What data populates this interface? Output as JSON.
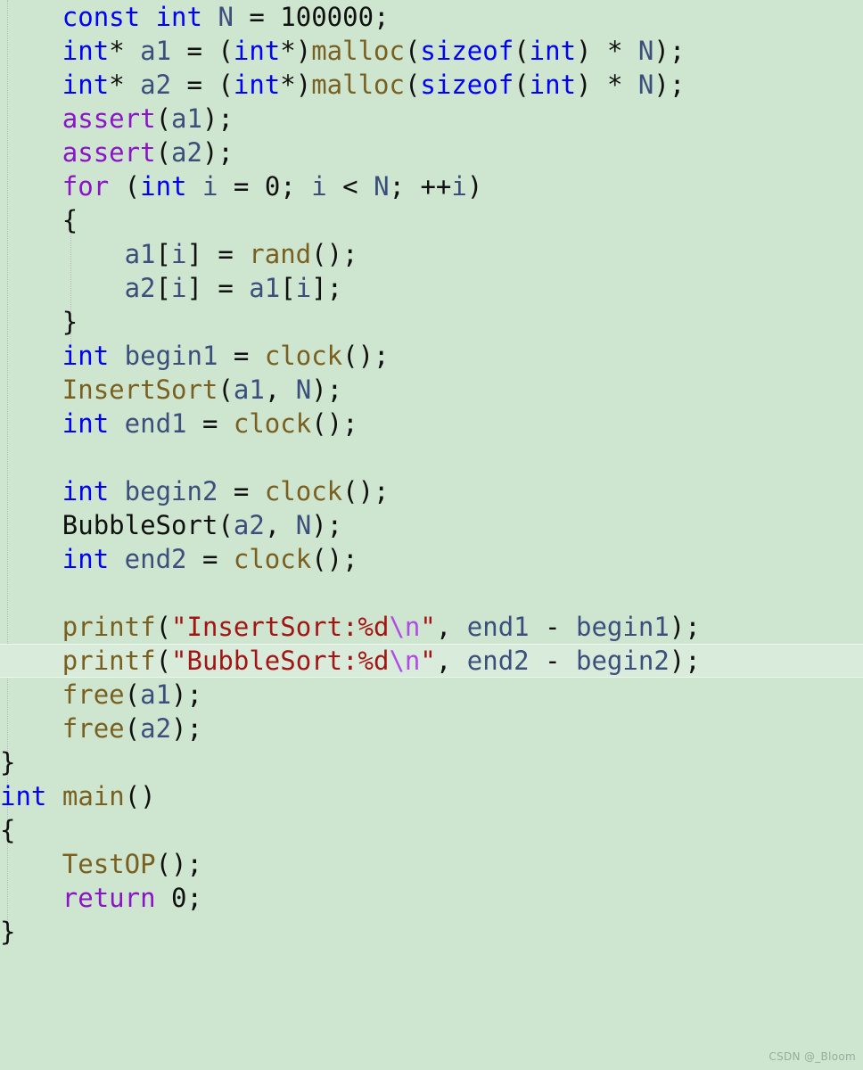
{
  "editor": {
    "background_color": "#cee6d0",
    "current_line_background": "#d9ecdb",
    "language": "C",
    "font_size_px": 29,
    "line_height_px": 38,
    "indent_guide_color": "#b9b2bd",
    "current_line_number_in_view": 18
  },
  "palette": {
    "keyword": "#0000ff",
    "control": "#8b13c9",
    "macro": "#8b13c9",
    "function": "#7a6020",
    "variable": "#3c4f7c",
    "string": "#a31515",
    "escape": "#b14ae8",
    "number": "#101010",
    "punctuation": "#101010",
    "plain": "#101010"
  },
  "watermark": {
    "text": "CSDN @_Bloom"
  },
  "code": {
    "lines": [
      {
        "indent": 4,
        "current": false,
        "tokens": [
          {
            "t": "const",
            "c": "kw"
          },
          {
            "t": " ",
            "c": "pun"
          },
          {
            "t": "int",
            "c": "kw"
          },
          {
            "t": " ",
            "c": "pun"
          },
          {
            "t": "N",
            "c": "var"
          },
          {
            "t": " = ",
            "c": "pun"
          },
          {
            "t": "100000",
            "c": "num"
          },
          {
            "t": ";",
            "c": "pun"
          }
        ]
      },
      {
        "indent": 4,
        "current": false,
        "tokens": [
          {
            "t": "int",
            "c": "kw"
          },
          {
            "t": "* ",
            "c": "pun"
          },
          {
            "t": "a1",
            "c": "var"
          },
          {
            "t": " = (",
            "c": "pun"
          },
          {
            "t": "int",
            "c": "kw"
          },
          {
            "t": "*)",
            "c": "pun"
          },
          {
            "t": "malloc",
            "c": "fn"
          },
          {
            "t": "(",
            "c": "pun"
          },
          {
            "t": "sizeof",
            "c": "kw"
          },
          {
            "t": "(",
            "c": "pun"
          },
          {
            "t": "int",
            "c": "kw"
          },
          {
            "t": ") * ",
            "c": "pun"
          },
          {
            "t": "N",
            "c": "var"
          },
          {
            "t": ");",
            "c": "pun"
          }
        ]
      },
      {
        "indent": 4,
        "current": false,
        "tokens": [
          {
            "t": "int",
            "c": "kw"
          },
          {
            "t": "* ",
            "c": "pun"
          },
          {
            "t": "a2",
            "c": "var"
          },
          {
            "t": " = (",
            "c": "pun"
          },
          {
            "t": "int",
            "c": "kw"
          },
          {
            "t": "*)",
            "c": "pun"
          },
          {
            "t": "malloc",
            "c": "fn"
          },
          {
            "t": "(",
            "c": "pun"
          },
          {
            "t": "sizeof",
            "c": "kw"
          },
          {
            "t": "(",
            "c": "pun"
          },
          {
            "t": "int",
            "c": "kw"
          },
          {
            "t": ") * ",
            "c": "pun"
          },
          {
            "t": "N",
            "c": "var"
          },
          {
            "t": ");",
            "c": "pun"
          }
        ]
      },
      {
        "indent": 4,
        "current": false,
        "tokens": [
          {
            "t": "assert",
            "c": "mac"
          },
          {
            "t": "(",
            "c": "pun"
          },
          {
            "t": "a1",
            "c": "var"
          },
          {
            "t": ");",
            "c": "pun"
          }
        ]
      },
      {
        "indent": 4,
        "current": false,
        "tokens": [
          {
            "t": "assert",
            "c": "mac"
          },
          {
            "t": "(",
            "c": "pun"
          },
          {
            "t": "a2",
            "c": "var"
          },
          {
            "t": ");",
            "c": "pun"
          }
        ]
      },
      {
        "indent": 4,
        "current": false,
        "tokens": [
          {
            "t": "for",
            "c": "ctl"
          },
          {
            "t": " (",
            "c": "pun"
          },
          {
            "t": "int",
            "c": "kw"
          },
          {
            "t": " ",
            "c": "pun"
          },
          {
            "t": "i",
            "c": "var"
          },
          {
            "t": " = ",
            "c": "pun"
          },
          {
            "t": "0",
            "c": "num"
          },
          {
            "t": "; ",
            "c": "pun"
          },
          {
            "t": "i",
            "c": "var"
          },
          {
            "t": " < ",
            "c": "pun"
          },
          {
            "t": "N",
            "c": "var"
          },
          {
            "t": "; ++",
            "c": "pun"
          },
          {
            "t": "i",
            "c": "var"
          },
          {
            "t": ")",
            "c": "pun"
          }
        ]
      },
      {
        "indent": 4,
        "current": false,
        "tokens": [
          {
            "t": "{",
            "c": "pun"
          }
        ]
      },
      {
        "indent": 8,
        "current": false,
        "tokens": [
          {
            "t": "a1",
            "c": "var"
          },
          {
            "t": "[",
            "c": "pun"
          },
          {
            "t": "i",
            "c": "var"
          },
          {
            "t": "] = ",
            "c": "pun"
          },
          {
            "t": "rand",
            "c": "fn"
          },
          {
            "t": "();",
            "c": "pun"
          }
        ]
      },
      {
        "indent": 8,
        "current": false,
        "tokens": [
          {
            "t": "a2",
            "c": "var"
          },
          {
            "t": "[",
            "c": "pun"
          },
          {
            "t": "i",
            "c": "var"
          },
          {
            "t": "] = ",
            "c": "pun"
          },
          {
            "t": "a1",
            "c": "var"
          },
          {
            "t": "[",
            "c": "pun"
          },
          {
            "t": "i",
            "c": "var"
          },
          {
            "t": "];",
            "c": "pun"
          }
        ]
      },
      {
        "indent": 4,
        "current": false,
        "tokens": [
          {
            "t": "}",
            "c": "pun"
          }
        ]
      },
      {
        "indent": 4,
        "current": false,
        "tokens": [
          {
            "t": "int",
            "c": "kw"
          },
          {
            "t": " ",
            "c": "pun"
          },
          {
            "t": "begin1",
            "c": "var"
          },
          {
            "t": " = ",
            "c": "pun"
          },
          {
            "t": "clock",
            "c": "fn"
          },
          {
            "t": "();",
            "c": "pun"
          }
        ]
      },
      {
        "indent": 4,
        "current": false,
        "tokens": [
          {
            "t": "InsertSort",
            "c": "fn"
          },
          {
            "t": "(",
            "c": "pun"
          },
          {
            "t": "a1",
            "c": "var"
          },
          {
            "t": ", ",
            "c": "pun"
          },
          {
            "t": "N",
            "c": "var"
          },
          {
            "t": ");",
            "c": "pun"
          }
        ]
      },
      {
        "indent": 4,
        "current": false,
        "tokens": [
          {
            "t": "int",
            "c": "kw"
          },
          {
            "t": " ",
            "c": "pun"
          },
          {
            "t": "end1",
            "c": "var"
          },
          {
            "t": " = ",
            "c": "pun"
          },
          {
            "t": "clock",
            "c": "fn"
          },
          {
            "t": "();",
            "c": "pun"
          }
        ]
      },
      {
        "indent": 0,
        "current": false,
        "tokens": []
      },
      {
        "indent": 4,
        "current": false,
        "tokens": [
          {
            "t": "int",
            "c": "kw"
          },
          {
            "t": " ",
            "c": "pun"
          },
          {
            "t": "begin2",
            "c": "var"
          },
          {
            "t": " = ",
            "c": "pun"
          },
          {
            "t": "clock",
            "c": "fn"
          },
          {
            "t": "();",
            "c": "pun"
          }
        ]
      },
      {
        "indent": 4,
        "current": false,
        "tokens": [
          {
            "t": "BubbleSort",
            "c": "plain"
          },
          {
            "t": "(",
            "c": "pun"
          },
          {
            "t": "a2",
            "c": "var"
          },
          {
            "t": ", ",
            "c": "pun"
          },
          {
            "t": "N",
            "c": "var"
          },
          {
            "t": ");",
            "c": "pun"
          }
        ]
      },
      {
        "indent": 4,
        "current": false,
        "tokens": [
          {
            "t": "int",
            "c": "kw"
          },
          {
            "t": " ",
            "c": "pun"
          },
          {
            "t": "end2",
            "c": "var"
          },
          {
            "t": " = ",
            "c": "pun"
          },
          {
            "t": "clock",
            "c": "fn"
          },
          {
            "t": "();",
            "c": "pun"
          }
        ]
      },
      {
        "indent": 0,
        "current": false,
        "tokens": []
      },
      {
        "indent": 4,
        "current": false,
        "tokens": [
          {
            "t": "printf",
            "c": "fn"
          },
          {
            "t": "(",
            "c": "pun"
          },
          {
            "t": "\"InsertSort:%d",
            "c": "str"
          },
          {
            "t": "\\n",
            "c": "esc"
          },
          {
            "t": "\"",
            "c": "str"
          },
          {
            "t": ", ",
            "c": "pun"
          },
          {
            "t": "end1",
            "c": "var"
          },
          {
            "t": " - ",
            "c": "pun"
          },
          {
            "t": "begin1",
            "c": "var"
          },
          {
            "t": ");",
            "c": "pun"
          }
        ]
      },
      {
        "indent": 4,
        "current": true,
        "tokens": [
          {
            "t": "printf",
            "c": "fn"
          },
          {
            "t": "(",
            "c": "pun"
          },
          {
            "t": "\"BubbleSort:%d",
            "c": "str"
          },
          {
            "t": "\\n",
            "c": "esc"
          },
          {
            "t": "\"",
            "c": "str"
          },
          {
            "t": ", ",
            "c": "pun"
          },
          {
            "t": "end2",
            "c": "var"
          },
          {
            "t": " - ",
            "c": "pun"
          },
          {
            "t": "begin2",
            "c": "var"
          },
          {
            "t": ");",
            "c": "pun"
          }
        ]
      },
      {
        "indent": 4,
        "current": false,
        "tokens": [
          {
            "t": "free",
            "c": "fn"
          },
          {
            "t": "(",
            "c": "pun"
          },
          {
            "t": "a1",
            "c": "var"
          },
          {
            "t": ");",
            "c": "pun"
          }
        ]
      },
      {
        "indent": 4,
        "current": false,
        "tokens": [
          {
            "t": "free",
            "c": "fn"
          },
          {
            "t": "(",
            "c": "pun"
          },
          {
            "t": "a2",
            "c": "var"
          },
          {
            "t": ");",
            "c": "pun"
          }
        ]
      },
      {
        "indent": 0,
        "current": false,
        "tokens": [
          {
            "t": "}",
            "c": "pun"
          }
        ]
      },
      {
        "indent": 0,
        "current": false,
        "tokens": [
          {
            "t": "int",
            "c": "kw"
          },
          {
            "t": " ",
            "c": "pun"
          },
          {
            "t": "main",
            "c": "fn"
          },
          {
            "t": "()",
            "c": "pun"
          }
        ]
      },
      {
        "indent": 0,
        "current": false,
        "tokens": [
          {
            "t": "{",
            "c": "pun"
          }
        ]
      },
      {
        "indent": 4,
        "current": false,
        "tokens": [
          {
            "t": "TestOP",
            "c": "fn"
          },
          {
            "t": "();",
            "c": "pun"
          }
        ]
      },
      {
        "indent": 4,
        "current": false,
        "tokens": [
          {
            "t": "return",
            "c": "ctl"
          },
          {
            "t": " ",
            "c": "pun"
          },
          {
            "t": "0",
            "c": "num"
          },
          {
            "t": ";",
            "c": "pun"
          }
        ]
      },
      {
        "indent": 0,
        "current": false,
        "tokens": [
          {
            "t": "}",
            "c": "pun"
          }
        ]
      }
    ]
  }
}
